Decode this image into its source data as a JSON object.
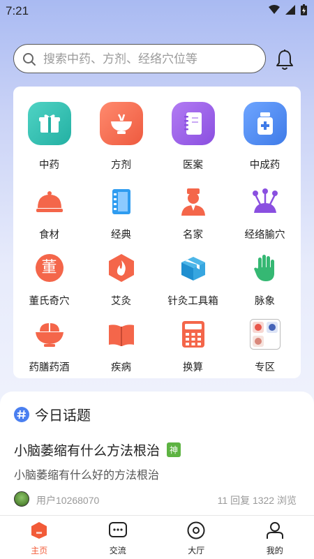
{
  "status": {
    "time": "7:21"
  },
  "search": {
    "placeholder": "搜索中药、方剂、经络穴位等"
  },
  "grid": [
    {
      "label": "中药"
    },
    {
      "label": "方剂"
    },
    {
      "label": "医案"
    },
    {
      "label": "中成药"
    },
    {
      "label": "食材"
    },
    {
      "label": "经典"
    },
    {
      "label": "名家"
    },
    {
      "label": "经络腧穴"
    },
    {
      "label": "董氏奇穴",
      "glyph": "董"
    },
    {
      "label": "艾灸"
    },
    {
      "label": "针灸工具箱"
    },
    {
      "label": "脉象"
    },
    {
      "label": "药膳药酒"
    },
    {
      "label": "疾病"
    },
    {
      "label": "换算"
    },
    {
      "label": "专区"
    }
  ],
  "topic": {
    "heading": "今日话题",
    "title": "小脑萎缩有什么方法根治",
    "badge": "神",
    "subtitle": "小脑萎缩有什么好的方法根治",
    "user": "用户10268070",
    "stats": "11 回复   1322 浏览"
  },
  "tabs": [
    {
      "label": "主页",
      "active": true
    },
    {
      "label": "交流",
      "active": false
    },
    {
      "label": "大厅",
      "active": false
    },
    {
      "label": "我的",
      "active": false
    }
  ],
  "colors": {
    "accent": "#f25b38",
    "badge": "#5db342"
  }
}
